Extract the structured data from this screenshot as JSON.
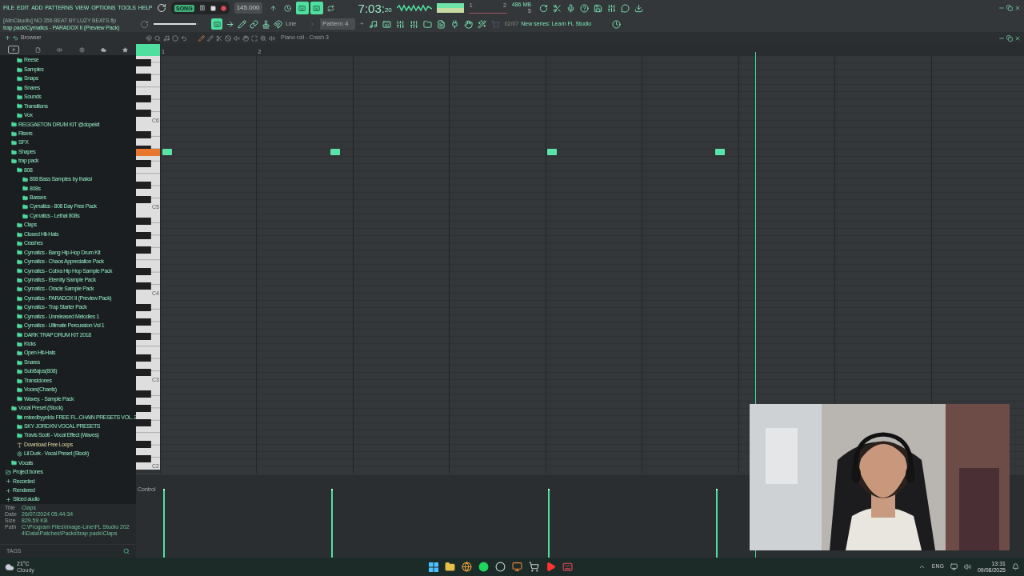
{
  "menu": [
    "FILE",
    "EDIT",
    "ADD",
    "PATTERNS",
    "VIEW",
    "OPTIONS",
    "TOOLS",
    "HELP"
  ],
  "transport": {
    "mode_label": "SONG",
    "song_mode": true,
    "tempo": "145.000"
  },
  "toolbar_toggles": [
    {
      "on": false
    },
    {
      "on": false
    },
    {
      "on": true
    },
    {
      "on": true
    },
    {
      "on": false
    }
  ],
  "clock": {
    "main": "7:03:",
    "ticks": "20"
  },
  "pattern_position": {
    "start": "1",
    "end": "2"
  },
  "memory": {
    "usage": "486 MB",
    "polyphony": "5"
  },
  "project": {
    "file": "[AlinClaudiu] NO 356 BEAT BY LUZY BEATS.flp",
    "hint": "trap pack\\Cymatics - PARADOX II (Preview Pack)"
  },
  "master_volume": {
    "level": 0.95
  },
  "snap": {
    "on": true,
    "mode": "Line"
  },
  "pattern": {
    "name": "Pattern 4",
    "add": "+"
  },
  "news": {
    "date": "02/07",
    "text": "New series: Learn FL Studio"
  },
  "browser": {
    "title": "Browser",
    "tree": [
      {
        "children": [
          {
            "children": [
              {
                "label": "Reese",
                "kind": "folder"
              },
              {
                "label": "Samples",
                "kind": "folder"
              },
              {
                "label": "Snaps",
                "kind": "folder"
              },
              {
                "label": "Snares",
                "kind": "folder"
              },
              {
                "label": "Sounds",
                "kind": "folder"
              },
              {
                "label": "Transitions",
                "kind": "folder"
              },
              {
                "label": "Vox",
                "kind": "folder"
              }
            ]
          },
          {
            "label": "REGGAETON DRUM KIT @dopekit",
            "kind": "folder"
          },
          {
            "label": "Risers",
            "kind": "folder"
          },
          {
            "label": "SFX",
            "kind": "folder"
          },
          {
            "label": "Shapes",
            "kind": "folder"
          },
          {
            "label": "trap pack",
            "kind": "folder",
            "children": [
              {
                "label": "808",
                "kind": "folder",
                "children": [
                  {
                    "label": "808 Bass Samples by Ihaksi",
                    "kind": "folder"
                  },
                  {
                    "label": "808s",
                    "kind": "folder"
                  },
                  {
                    "label": "Basses",
                    "kind": "folder"
                  },
                  {
                    "label": "Cymatics - 808 Day Free Pack",
                    "kind": "folder"
                  },
                  {
                    "label": "Cymatics - Lethal 808s",
                    "kind": "folder"
                  }
                ]
              },
              {
                "label": "Claps",
                "kind": "folder"
              },
              {
                "label": "Closed Hit-Hats",
                "kind": "folder"
              },
              {
                "label": "Crashes",
                "kind": "folder"
              },
              {
                "label": "Cymatics - Bang Hip-Hop Drum Kit",
                "kind": "folder"
              },
              {
                "label": "Cymatics - Chaos Appreciation Pack",
                "kind": "folder"
              },
              {
                "label": "Cymatics - Cobra Hip Hop Sample Pack",
                "kind": "folder"
              },
              {
                "label": "Cymatics - Eternity Sample Pack",
                "kind": "folder"
              },
              {
                "label": "Cymatics - Oracle Sample Pack",
                "kind": "folder"
              },
              {
                "label": "Cymatics - PARADOX II (Preview Pack)",
                "kind": "folder"
              },
              {
                "label": "Cymatics - Trap Starter Pack",
                "kind": "folder"
              },
              {
                "label": "Cymatics - Unreleased Melodies 1",
                "kind": "folder"
              },
              {
                "label": "Cymatics - Ultimate Percussion Vol 1",
                "kind": "folder"
              },
              {
                "label": "DARK TRAP DRUM KIT 2018",
                "kind": "folder"
              },
              {
                "label": "Kicks",
                "kind": "folder"
              },
              {
                "label": "Open Hit-Hats",
                "kind": "folder"
              },
              {
                "label": "Snares",
                "kind": "folder"
              },
              {
                "label": "SubBajos(808)",
                "kind": "folder"
              },
              {
                "label": "Transiciones",
                "kind": "folder"
              },
              {
                "label": "Voces(Chants)",
                "kind": "folder"
              },
              {
                "label": "Wavey. - Sample Pack",
                "kind": "folder"
              }
            ]
          },
          {
            "label": "Vocal Preset (Stock)",
            "kind": "folder",
            "children": [
              {
                "label": "mixedbyyeldo FREE FL..CHAIN PRESETS VOL. 2",
                "kind": "folder"
              },
              {
                "label": "SKY JORDXN VOCAL PRESETS",
                "kind": "folder"
              },
              {
                "label": "Travis Scott - Vocal Effect (Waves)",
                "kind": "folder"
              },
              {
                "label": "Download Free Loops",
                "kind": "text"
              },
              {
                "label": "Lil Durk - Vocal Preset (Stock)",
                "kind": "preset"
              }
            ]
          },
          {
            "label": "Vocals",
            "kind": "folder"
          }
        ]
      },
      {
        "label": "Project bones",
        "kind": "project"
      },
      {
        "label": "Recorded",
        "kind": "audio"
      },
      {
        "label": "Rendered",
        "kind": "audio"
      },
      {
        "label": "Sliced audio",
        "kind": "audio"
      }
    ],
    "info": [
      {
        "label": "Title",
        "value": "Claps"
      },
      {
        "label": "Date",
        "value": "26/07/2024 05:44:34"
      },
      {
        "label": "Size",
        "value": "829.59 KB"
      },
      {
        "label": "Path",
        "value": "C:\\Program Files\\Image-Line\\FL Studio 2024\\Data\\Patches\\Packs\\trap pack\\Claps"
      }
    ],
    "tags_label": "TAGS"
  },
  "piano_roll": {
    "title": "Piano roll - Crash 3",
    "ruler": [
      "1",
      "2"
    ],
    "octaves": [
      "C6",
      "C5",
      "C4",
      "C3",
      "C2"
    ],
    "control_label": "Control"
  },
  "taskbar": {
    "temperature": "21°C",
    "weather": "Cloudy",
    "language": "ENG",
    "time": "13:31",
    "date": "09/08/2025"
  }
}
